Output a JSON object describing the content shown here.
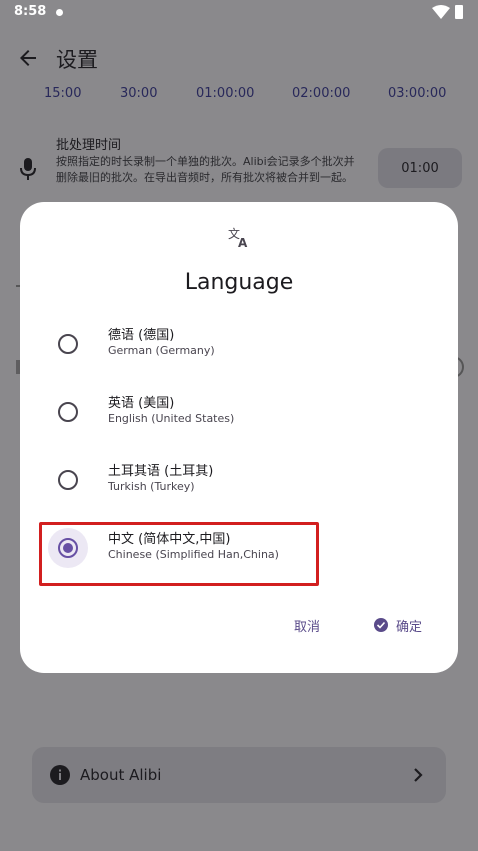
{
  "status_bar": {
    "time": "8:58"
  },
  "app_bar": {
    "title": "设置"
  },
  "durations": [
    "15:00",
    "30:00",
    "01:00:00",
    "02:00:00",
    "03:00:00"
  ],
  "batch": {
    "title": "批处理时间",
    "description": "按照指定的时长录制一个单独的批次。Alibi会记录多个批次并删除最旧的批次。在导出音频时，所有批次将被合并到一起。",
    "value": "01:00"
  },
  "about": {
    "label": "About Alibi"
  },
  "dialog": {
    "title": "Language",
    "options": [
      {
        "label": "德语 (德国)",
        "sub": "German (Germany)",
        "selected": false
      },
      {
        "label": "英语 (美国)",
        "sub": "English (United States)",
        "selected": false
      },
      {
        "label": "土耳其语 (土耳其)",
        "sub": "Turkish (Turkey)",
        "selected": false
      },
      {
        "label": "中文 (简体中文,中国)",
        "sub": "Chinese (Simplified Han,China)",
        "selected": true
      }
    ],
    "cancel_label": "取消",
    "ok_label": "确定"
  },
  "colors": {
    "accent": "#6750a4",
    "highlight": "#d21f1f",
    "scrim": "#8a898c"
  },
  "icons": [
    "wifi-icon",
    "battery-icon",
    "back-arrow-icon",
    "mic-icon",
    "translate-icon",
    "info-icon",
    "chevron-right-icon",
    "check-circle-icon"
  ]
}
